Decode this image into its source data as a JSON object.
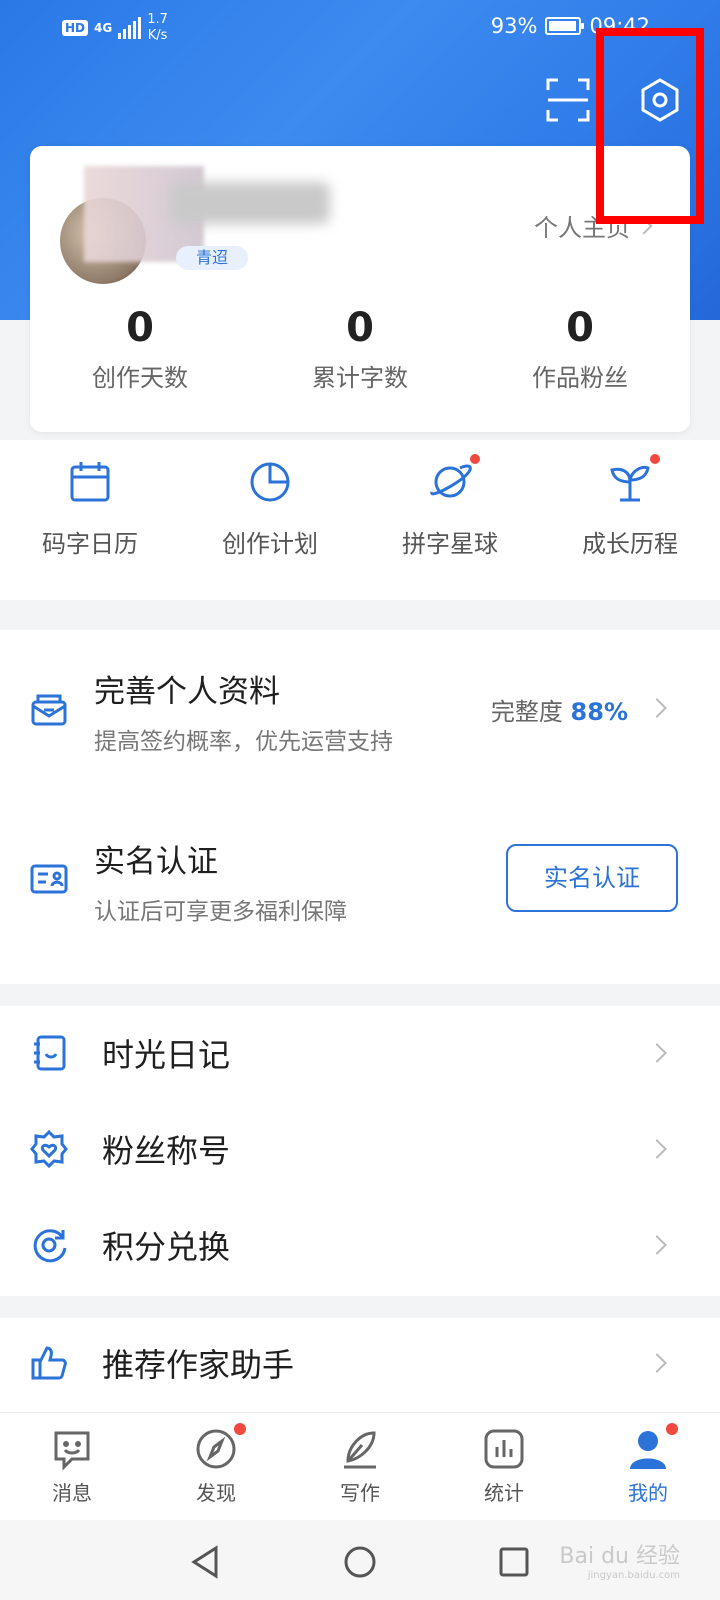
{
  "status_bar": {
    "hd": "HD",
    "network": "4G",
    "speed_value": "1.7",
    "speed_unit": "K/s",
    "battery_percent": "93%",
    "battery_level": 0.93,
    "time": "09:42"
  },
  "header": {
    "scan_icon": "scan-icon",
    "settings_icon": "settings-hex-icon"
  },
  "profile": {
    "level_badge": "青迢",
    "homepage_link": "个人主页",
    "stats": [
      {
        "value": "0",
        "label": "创作天数"
      },
      {
        "value": "0",
        "label": "累计字数"
      },
      {
        "value": "0",
        "label": "作品粉丝"
      }
    ]
  },
  "quick_actions": [
    {
      "label": "码字日历",
      "icon": "calendar-icon",
      "dot": false
    },
    {
      "label": "创作计划",
      "icon": "pie-chart-icon",
      "dot": false
    },
    {
      "label": "拼字星球",
      "icon": "planet-icon",
      "dot": true
    },
    {
      "label": "成长历程",
      "icon": "sprout-icon",
      "dot": true
    }
  ],
  "profile_section": {
    "complete_title": "完善个人资料",
    "complete_sub": "提高签约概率，优先运营支持",
    "completeness_label": "完整度",
    "completeness_value": "88%",
    "verify_title": "实名认证",
    "verify_sub": "认证后可享更多福利保障",
    "verify_button": "实名认证"
  },
  "menu": [
    {
      "label": "时光日记",
      "icon": "diary-icon"
    },
    {
      "label": "粉丝称号",
      "icon": "fan-badge-icon"
    },
    {
      "label": "积分兑换",
      "icon": "points-exchange-icon"
    }
  ],
  "recommend": {
    "label": "推荐作家助手",
    "icon": "thumbs-up-icon"
  },
  "bottom_nav": [
    {
      "label": "消息",
      "icon": "message-icon",
      "dot": false,
      "active": false
    },
    {
      "label": "发现",
      "icon": "compass-icon",
      "dot": true,
      "active": false
    },
    {
      "label": "写作",
      "icon": "feather-pen-icon",
      "dot": false,
      "active": false
    },
    {
      "label": "统计",
      "icon": "bar-chart-icon",
      "dot": false,
      "active": false
    },
    {
      "label": "我的",
      "icon": "person-icon",
      "dot": true,
      "active": true
    }
  ],
  "watermark": {
    "text": "Bai du 经验",
    "url": "jingyan.baidu.com"
  },
  "colors": {
    "accent": "#2b72d9",
    "header_blue": "#2f7be8",
    "red_dot": "#f04a3e",
    "highlight": "#ff0000"
  }
}
